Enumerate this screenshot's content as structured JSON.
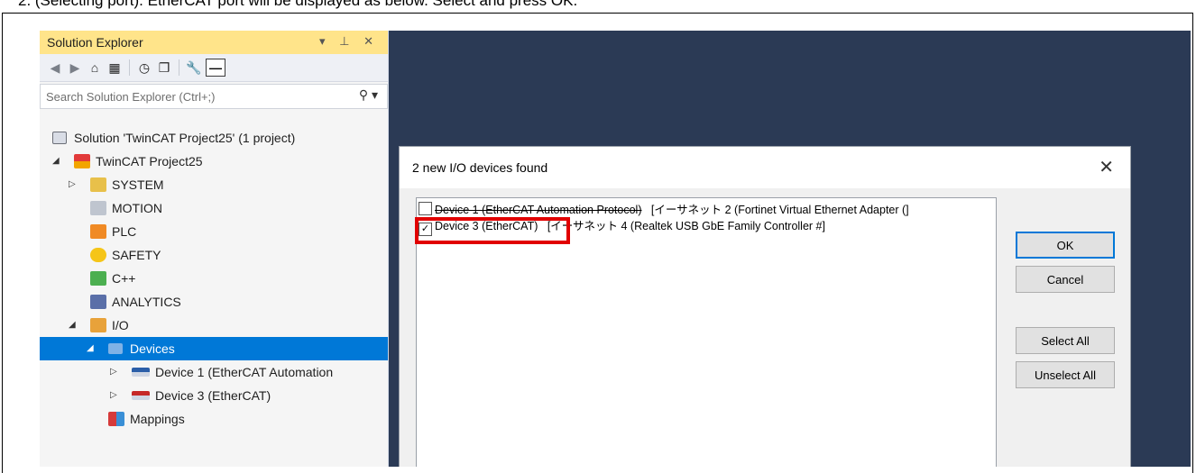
{
  "caption": "2.    (Selecting port). EtherCAT port will be displayed as below. Select and press OK.",
  "solution_explorer": {
    "title": "Solution Explorer",
    "controls": "▾ ⊥ ✕",
    "search_placeholder": "Search Solution Explorer (Ctrl+;)",
    "tree": [
      {
        "label": "Solution 'TwinCAT Project25' (1 project)",
        "icon": "solution-icon",
        "level": 0,
        "arrow": ""
      },
      {
        "label": "TwinCAT Project25",
        "icon": "project-icon",
        "level": 0,
        "arrow": "expanded"
      },
      {
        "label": "SYSTEM",
        "icon": "system-icon",
        "level": 1,
        "arrow": "collapsed"
      },
      {
        "label": "MOTION",
        "icon": "motion-icon",
        "level": 1,
        "arrow": ""
      },
      {
        "label": "PLC",
        "icon": "plc-icon",
        "level": 1,
        "arrow": ""
      },
      {
        "label": "SAFETY",
        "icon": "safety-icon",
        "level": 1,
        "arrow": ""
      },
      {
        "label": "C++",
        "icon": "cpp-icon",
        "level": 1,
        "arrow": ""
      },
      {
        "label": "ANALYTICS",
        "icon": "analytics-icon",
        "level": 1,
        "arrow": ""
      },
      {
        "label": "I/O",
        "icon": "io-icon",
        "level": 1,
        "arrow": "expanded"
      },
      {
        "label": "Devices",
        "icon": "devices-icon",
        "level": 2,
        "arrow": "expanded",
        "selected": true
      },
      {
        "label": "Device 1 (EtherCAT Automation",
        "icon": "ethercat-device-icon",
        "level": 3,
        "arrow": "collapsed"
      },
      {
        "label": "Device 3 (EtherCAT)",
        "icon": "ethercat-device-icon",
        "level": 3,
        "arrow": "collapsed"
      },
      {
        "label": "Mappings",
        "icon": "mappings-icon",
        "level": 2,
        "arrow": ""
      }
    ]
  },
  "dialog": {
    "title": "2 new I/O devices found",
    "devices": [
      {
        "name": "Device 1 (EtherCAT Automation Protocol)",
        "adapter": "[イーサネット 2 (Fortinet Virtual Ethernet Adapter (]",
        "checked": false
      },
      {
        "name": "Device 3 (EtherCAT)",
        "adapter": "[イーサネット 4 (Realtek USB GbE Family Controller #]",
        "checked": true
      }
    ],
    "buttons": {
      "ok": "OK",
      "cancel": "Cancel",
      "select_all": "Select All",
      "unselect_all": "Unselect All"
    }
  },
  "colors": {
    "highlight": "#e10000",
    "selection": "#0078d7",
    "background": "#2b3a55"
  }
}
